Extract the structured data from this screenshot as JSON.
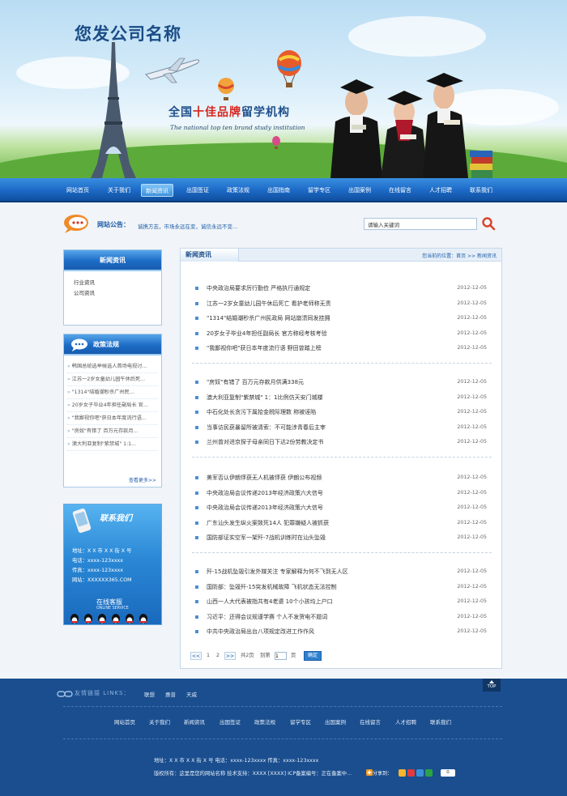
{
  "header": {
    "site_title": "您发公司名称",
    "slogan_prefix": "全国",
    "slogan_highlight": "十佳品牌",
    "slogan_suffix": "留学机构",
    "slogan_en": "The national top ten brand study institution"
  },
  "nav": {
    "items": [
      "网站首页",
      "关于我们",
      "新闻资讯",
      "出国签证",
      "政策法规",
      "出国指南",
      "留学专区",
      "出国案例",
      "在线留言",
      "人才招聘",
      "联系我们"
    ],
    "active_index": 2
  },
  "notice": {
    "label": "网站公告：",
    "text": "诚携方志，市场永远在变，诚信永远不变...",
    "search_placeholder": "请输入关键词"
  },
  "sidebar": {
    "news_title": "新闻资讯",
    "news_items": [
      "行业资讯",
      "公司资讯"
    ],
    "policy_title": "政策法规",
    "policy_items": [
      "韩国总统选举候选人首场电视讨...",
      "江苏一2岁女童幼儿园午休后死...",
      "\"1314\"结婚潮秒杀广州民...",
      "20岁女子毕业4年担任副局长 官...",
      "\"我鄙视你吧\"获日本年度流行语...",
      "\"房奴\"有错了 百万元存款月...",
      "澳大利亚复制\"紫禁城\" 1:1..."
    ],
    "more_label": "查看更多>>",
    "contact_title": "联系我们",
    "contact_address": "地址：X X 市 X X 街 X 号",
    "contact_phone": "电话：xxxx-123xxxx",
    "contact_fax": "传真：xxxx-123xxxx",
    "contact_web": "网站：XXXXXX365.COM",
    "service_title": "在线客服",
    "service_sub": "ONLINE SERVICE"
  },
  "panel": {
    "title": "新闻资讯",
    "breadcrumb": "您当前的位置：首页 >> 新闻资讯",
    "groups": [
      [
        {
          "title": "中央政治局要求厉行勤俭 严格执行通规定",
          "date": "2012-12-05"
        },
        {
          "title": "江苏一2岁女童幼儿园午休后死亡 看护老师称无责",
          "date": "2012-12-05"
        },
        {
          "title": "\"1314\"结婚潮秒杀广州民政局 网站崩溃同发挂拥",
          "date": "2012-12-05"
        },
        {
          "title": "20岁女子毕业4年担任副局长 官方称经考核考验",
          "date": "2012-12-05"
        },
        {
          "title": "\"我鄙视你吧\"获日本年度流行语 野田曾踏上榜",
          "date": "2012-12-05"
        }
      ],
      [
        {
          "title": "\"房奴\"有错了 百万元存款月供满338元",
          "date": "2012-12-05"
        },
        {
          "title": "澳大利亚复制\"紫禁城\" 1：1比例仿天安门城楼",
          "date": "2012-12-05"
        },
        {
          "title": "中石化处长贪污下属拾金税际理数 称被诬陷",
          "date": "2012-12-05"
        },
        {
          "title": "当事访民获暴留所被清索：不可能涉青春后主宰",
          "date": "2012-12-05"
        },
        {
          "title": "兰州曾对进京探子母亲同日下达2份劳教决定书",
          "date": "2012-12-05"
        }
      ],
      [
        {
          "title": "美军否认伊朗俘获无人机被俘获 伊朗公布视频",
          "date": "2012-12-05"
        },
        {
          "title": "中央政治局会议传递2013年经济政策六大信号",
          "date": "2012-12-05"
        },
        {
          "title": "中央政治局会议传递2013年经济政策六大信号",
          "date": "2012-12-05"
        },
        {
          "title": "广东汕头发生纵火案致死14人 犯罪嫌疑人被抓获",
          "date": "2012-12-05"
        },
        {
          "title": "国防部证实空军一架歼-7战机训练时在汕头坠毁",
          "date": "2012-12-05"
        }
      ],
      [
        {
          "title": "歼-15战机坠毁引发外媒关注 专家解释为何不飞到无人区",
          "date": "2012-12-05"
        },
        {
          "title": "国防部：坠毁歼-15突发机械故障 飞机状态无法控制",
          "date": "2012-12-05"
        },
        {
          "title": "山西一人大代表被指共有4老婆 10个小孩均上户口",
          "date": "2012-12-05"
        },
        {
          "title": "习近平：还得会议规谨学赛 个人不发贺电不题词",
          "date": "2012-12-05"
        },
        {
          "title": "中共中央政治局出台八项规定改进工作作风",
          "date": "2012-12-05"
        }
      ]
    ],
    "pager": {
      "prev": "<<",
      "page1": "1",
      "page2": "2",
      "next": ">>",
      "total": "共2页",
      "goto_label": "到第",
      "page_value": "1",
      "page_suffix": "页",
      "go_label": "确定"
    }
  },
  "footer": {
    "links_label": "友情链接 LINKS：",
    "links": [
      "联想",
      "惠普",
      "天威"
    ],
    "top_label": "TOP",
    "nav": [
      "网站首页",
      "关于我们",
      "新闻资讯",
      "出国签证",
      "政策法规",
      "留学专区",
      "出国案例",
      "在线留言",
      "人才招聘",
      "联系我们"
    ],
    "address": "地址：X X 市 X X 街 X 号 电话：xxxx-123xxxx 传真：xxxx-123xxxx",
    "copyright": "版权所有：这里是您的网站名称 技术支持：XXXX [XXXX] ICP备案编号：正在备案中...",
    "share_label": "分享到：",
    "share_count": "0"
  },
  "colors": {
    "nav_blue": "#1e6cc8",
    "footer_blue": "#1a4e8f",
    "title_blue": "#1a4c86",
    "slogan_red": "#d7261e"
  }
}
